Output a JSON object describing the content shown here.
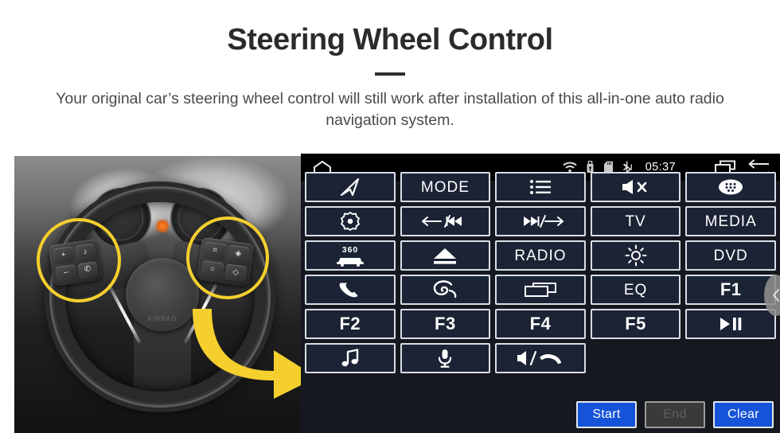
{
  "header": {
    "title": "Steering Wheel Control",
    "subtitle": "Your original car’s steering wheel control will still work after installation of this all-in-one auto radio navigation system."
  },
  "photo": {
    "alt": "steering-wheel-with-highlighted-controls",
    "airbag_text": "AIRBAG",
    "pod_left_keys": [
      "+",
      "♪",
      "–",
      "✆"
    ],
    "pod_right_keys": [
      "⌗",
      "◈",
      "○",
      "◇"
    ],
    "highlight_color": "#f5cf2e",
    "arrow_color": "#f5cf2e"
  },
  "head_unit": {
    "statusbar": {
      "home_icon": "home-icon",
      "wifi_icon": "wifi-icon",
      "usb_icon": "usb-icon",
      "sdcard_icon": "sd-card-icon",
      "bluetooth_icon": "bluetooth-icon",
      "time": "05:37",
      "recents_icon": "recent-apps-icon",
      "back_icon": "back-icon"
    },
    "slider_handle_icon": "chevron-left-icon",
    "rows": [
      [
        {
          "name": "navigation",
          "type": "icon",
          "icon": "navigation-arrow-icon",
          "label": ""
        },
        {
          "name": "mode",
          "type": "text",
          "icon": "",
          "label": "MODE"
        },
        {
          "name": "list",
          "type": "icon",
          "icon": "list-icon",
          "label": ""
        },
        {
          "name": "mute",
          "type": "icon",
          "icon": "speaker-mute-icon",
          "label": ""
        },
        {
          "name": "apps",
          "type": "icon",
          "icon": "apps-grid-icon",
          "label": ""
        }
      ],
      [
        {
          "name": "power-settings",
          "type": "icon",
          "icon": "gear-dot-icon",
          "label": ""
        },
        {
          "name": "previous-track",
          "type": "icon",
          "icon": "prev-track-icon",
          "label": ""
        },
        {
          "name": "next-track",
          "type": "icon",
          "icon": "next-track-icon",
          "label": ""
        },
        {
          "name": "tv",
          "type": "text",
          "icon": "",
          "label": "TV"
        },
        {
          "name": "media",
          "type": "text",
          "icon": "",
          "label": "MEDIA"
        }
      ],
      [
        {
          "name": "camera-360",
          "type": "icon",
          "icon": "car-360-icon",
          "label": "360"
        },
        {
          "name": "eject",
          "type": "icon",
          "icon": "eject-icon",
          "label": ""
        },
        {
          "name": "radio",
          "type": "text",
          "icon": "",
          "label": "RADIO"
        },
        {
          "name": "brightness",
          "type": "icon",
          "icon": "brightness-icon",
          "label": ""
        },
        {
          "name": "dvd",
          "type": "text",
          "icon": "",
          "label": "DVD"
        }
      ],
      [
        {
          "name": "phone-call",
          "type": "icon",
          "icon": "phone-icon",
          "label": ""
        },
        {
          "name": "spiral",
          "type": "icon",
          "icon": "spiral-icon",
          "label": ""
        },
        {
          "name": "screen",
          "type": "icon",
          "icon": "screen-icon",
          "label": ""
        },
        {
          "name": "equalizer",
          "type": "text",
          "icon": "",
          "label": "EQ"
        },
        {
          "name": "f1",
          "type": "text",
          "icon": "",
          "label": "F1"
        }
      ],
      [
        {
          "name": "f2",
          "type": "text",
          "icon": "",
          "label": "F2"
        },
        {
          "name": "f3",
          "type": "text",
          "icon": "",
          "label": "F3"
        },
        {
          "name": "f4",
          "type": "text",
          "icon": "",
          "label": "F4"
        },
        {
          "name": "f5",
          "type": "text",
          "icon": "",
          "label": "F5"
        },
        {
          "name": "play-pause",
          "type": "icon",
          "icon": "play-pause-icon",
          "label": ""
        }
      ],
      [
        {
          "name": "music",
          "type": "icon",
          "icon": "music-note-icon",
          "label": ""
        },
        {
          "name": "voice",
          "type": "icon",
          "icon": "microphone-icon",
          "label": ""
        },
        {
          "name": "volume-hangup",
          "type": "icon",
          "icon": "volume-hangup-icon",
          "label": ""
        },
        {
          "name": "empty-1",
          "type": "empty",
          "icon": "",
          "label": ""
        },
        {
          "name": "empty-2",
          "type": "empty",
          "icon": "",
          "label": ""
        }
      ]
    ],
    "footer_buttons": [
      {
        "name": "start",
        "label": "Start",
        "state": "enabled"
      },
      {
        "name": "end",
        "label": "End",
        "state": "disabled"
      },
      {
        "name": "clear",
        "label": "Clear",
        "state": "enabled"
      }
    ]
  },
  "colors": {
    "button_fill": "#1b2335",
    "button_border": "#d8dde6",
    "accent_blue": "#1553d8",
    "panel_bg": "#15181e",
    "statusbar_bg": "#000000",
    "highlight_yellow": "#f5cf2e"
  }
}
